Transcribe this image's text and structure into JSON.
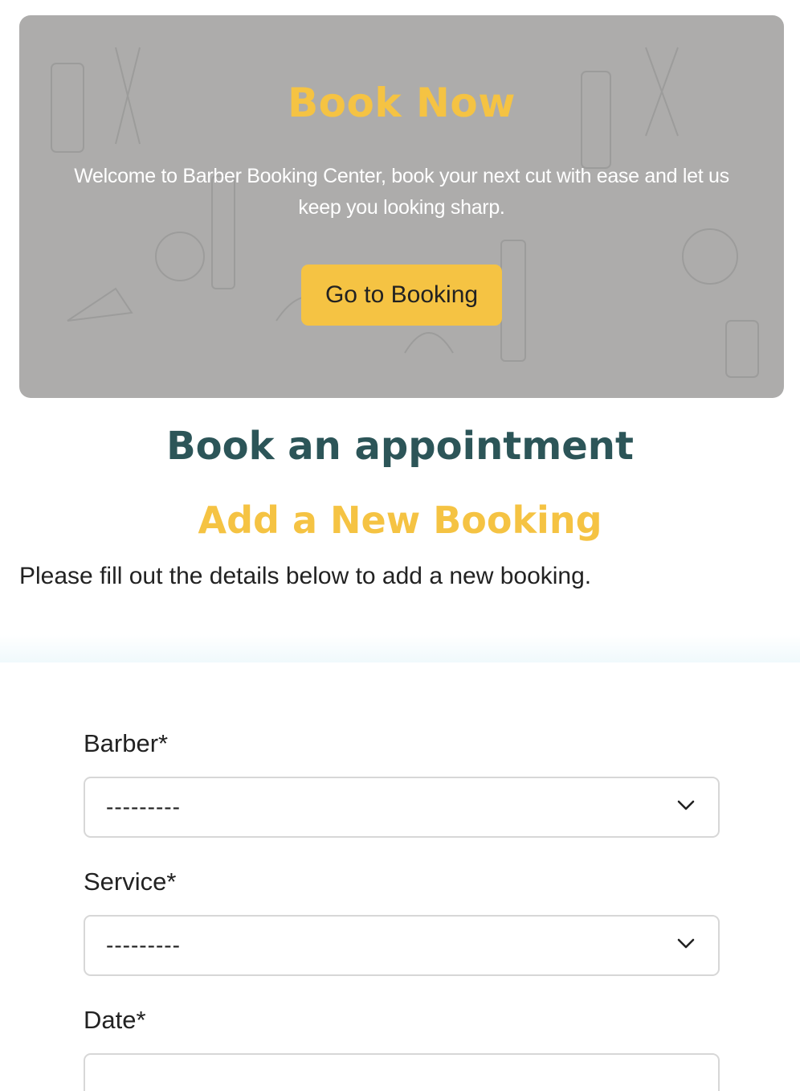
{
  "hero": {
    "title": "Book Now",
    "text": "Welcome to Barber Booking Center, book your next cut with ease and let us keep you looking sharp.",
    "button_label": "Go to Booking"
  },
  "page": {
    "title": "Book an appointment",
    "subtitle": "Add a New Booking",
    "intro": "Please fill out the details below to add a new booking."
  },
  "form": {
    "barber": {
      "label": "Barber*",
      "value": "---------",
      "icon": "chevron-down-icon"
    },
    "service": {
      "label": "Service*",
      "value": "---------",
      "icon": "chevron-down-icon"
    },
    "date": {
      "label": "Date*",
      "value": ""
    }
  },
  "colors": {
    "accent": "#f5c343",
    "heading": "#2c5558",
    "hero_bg": "#adacab"
  }
}
